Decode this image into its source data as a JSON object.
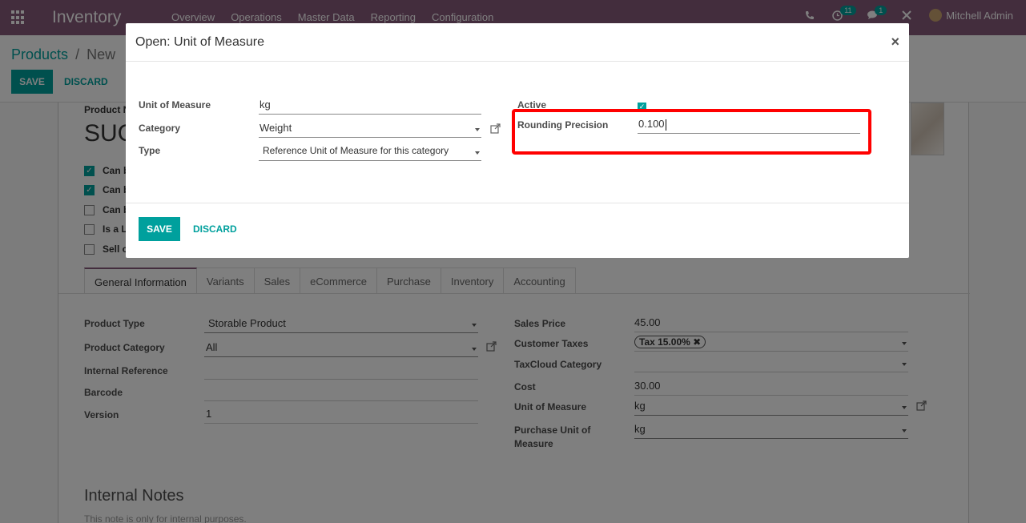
{
  "navbar": {
    "app_title": "Inventory",
    "menu": [
      "Overview",
      "Operations",
      "Master Data",
      "Reporting",
      "Configuration"
    ],
    "activity_count": "11",
    "message_count": "1",
    "user_name": "Mitchell Admin"
  },
  "breadcrumb": {
    "parent": "Products",
    "separator": "/",
    "current": "New"
  },
  "control": {
    "save_label": "SAVE",
    "discard_label": "DISCARD"
  },
  "product": {
    "name_label": "Product N",
    "name_value": "SUG",
    "checkboxes": [
      {
        "label": "Can b",
        "checked": true
      },
      {
        "label": "Can b",
        "checked": true
      },
      {
        "label": "Can b",
        "checked": false
      },
      {
        "label": "Is a L",
        "checked": false
      },
      {
        "label": "Sell o",
        "checked": false
      }
    ]
  },
  "tabs": [
    "General Information",
    "Variants",
    "Sales",
    "eCommerce",
    "Purchase",
    "Inventory",
    "Accounting"
  ],
  "general": {
    "product_type_label": "Product Type",
    "product_type_value": "Storable Product",
    "product_category_label": "Product Category",
    "product_category_value": "All",
    "internal_ref_label": "Internal Reference",
    "barcode_label": "Barcode",
    "version_label": "Version",
    "version_value": "1",
    "sales_price_label": "Sales Price",
    "sales_price_value": "45.00",
    "customer_taxes_label": "Customer Taxes",
    "customer_taxes_tag": "Tax 15.00%",
    "taxcloud_label": "TaxCloud Category",
    "cost_label": "Cost",
    "cost_value": "30.00",
    "uom_label": "Unit of Measure",
    "uom_value": "kg",
    "purchase_uom_label_1": "Purchase Unit of",
    "purchase_uom_label_2": "Measure",
    "purchase_uom_value": "kg"
  },
  "notes": {
    "title": "Internal Notes",
    "subtitle": "This note is only for internal purposes."
  },
  "modal": {
    "title": "Open: Unit of Measure",
    "close": "×",
    "uom_label": "Unit of Measure",
    "uom_value": "kg",
    "category_label": "Category",
    "category_value": "Weight",
    "type_label": "Type",
    "type_value": "Reference Unit of Measure for this category",
    "active_label": "Active",
    "active_checked": true,
    "rounding_label": "Rounding Precision",
    "rounding_value": "0.100",
    "save_label": "SAVE",
    "discard_label": "DISCARD"
  }
}
